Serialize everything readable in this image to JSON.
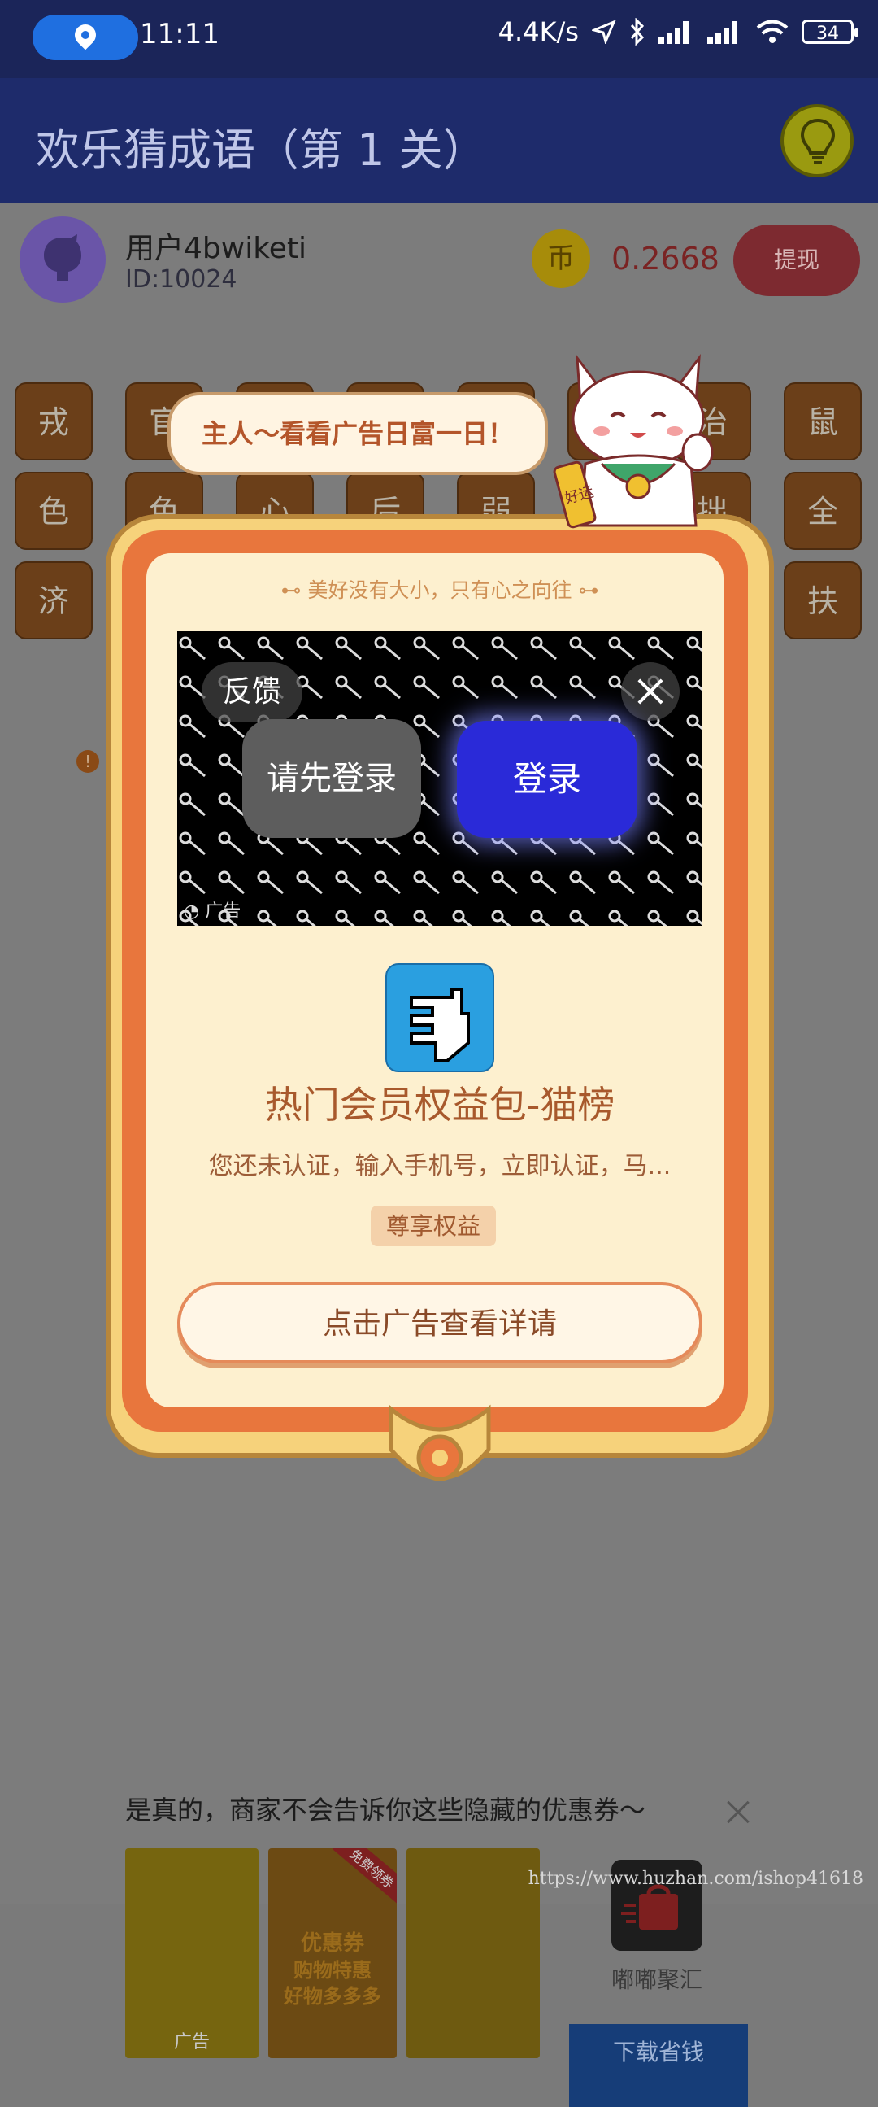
{
  "status_bar": {
    "time": "11:11",
    "net_speed": "4.4K/s",
    "battery": "34"
  },
  "header": {
    "title": "欢乐猜成语（第 1 关）"
  },
  "user": {
    "name": "用户4bwiketi",
    "id": "ID:10024",
    "coin_symbol": "币",
    "balance": "0.2668",
    "withdraw": "提现"
  },
  "grid": {
    "chars": [
      "戎",
      "官",
      "",
      "",
      "",
      "",
      "治",
      "鼠",
      "色",
      "色",
      "心",
      "后",
      "弱",
      "",
      "拙",
      "全",
      "济",
      "",
      "",
      "",
      "",
      "",
      "",
      "扶"
    ]
  },
  "mascot": {
    "speech": "主人～看看广告日富一日！",
    "sash": "好运"
  },
  "modal": {
    "motto": "美好没有大小，只有心之向往",
    "ad": {
      "feedback": "反馈",
      "login_first": "请先登录",
      "login": "登录",
      "tag": "广告"
    },
    "app_title": "热门会员权益包-猫榜",
    "app_desc": "您还未认证，输入手机号，立即认证，马...",
    "badge": "尊享权益",
    "cta": "点击广告查看详请"
  },
  "bottom_ad": {
    "title": "是真的，商家不会告诉你这些隐藏的优惠券～",
    "thumb_text": [
      "优惠券",
      "购物特惠",
      "好物多多多"
    ],
    "thumb_tag": "广告",
    "thumb_ribbon": "免费领券",
    "shop_name": "嘟嘟聚汇",
    "download": "下载省钱"
  },
  "watermark": "https://www.huzhan.com/ishop41618",
  "colors": {
    "header": "#1e2b6b",
    "frame_orange": "#e8763d",
    "frame_gold": "#f6d27b",
    "cream": "#fdf0cf",
    "login_blue": "#2a2ad8"
  }
}
